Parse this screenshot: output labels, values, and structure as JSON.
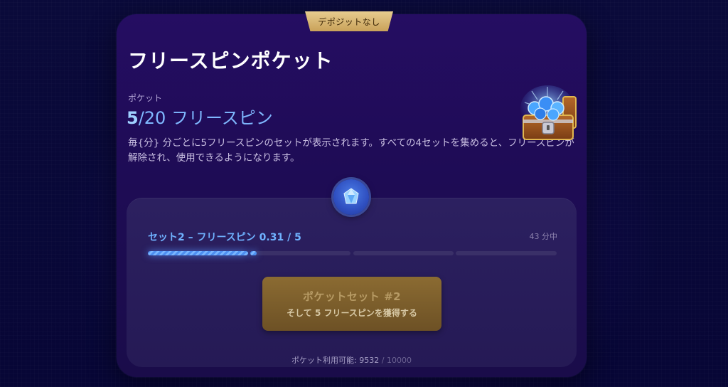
{
  "badge": {
    "label": "デポジットなし"
  },
  "header": {
    "title": "フリースピンポケット"
  },
  "pocket": {
    "label": "ポケット",
    "current": "5",
    "rest": "/20 フリースピン"
  },
  "description": "毎{分} 分ごとに5フリースピンのセットが表示されます。すべての4セットを集めると、フリースピンが解除され、使用できるようになります。",
  "progress": {
    "set_label": "セット2 – フリースピン 0.31 / 5",
    "time_label": "43 分中",
    "segments": 4,
    "completed_segments": 1,
    "current_fraction": 0.062
  },
  "claim_button": {
    "line1": "ポケットセット #2",
    "line2": "そして 5 フリースピンを獲得する"
  },
  "availability": {
    "prefix": "ポケット利用可能: ",
    "value": "9532",
    "total": " / 10000"
  },
  "icons": {
    "chest": "treasure-chest-icon",
    "gem": "gem-icon"
  },
  "colors": {
    "accent": "#6fb2ff",
    "gold": "#c9a25a",
    "card_bg": "#1e0c55"
  }
}
